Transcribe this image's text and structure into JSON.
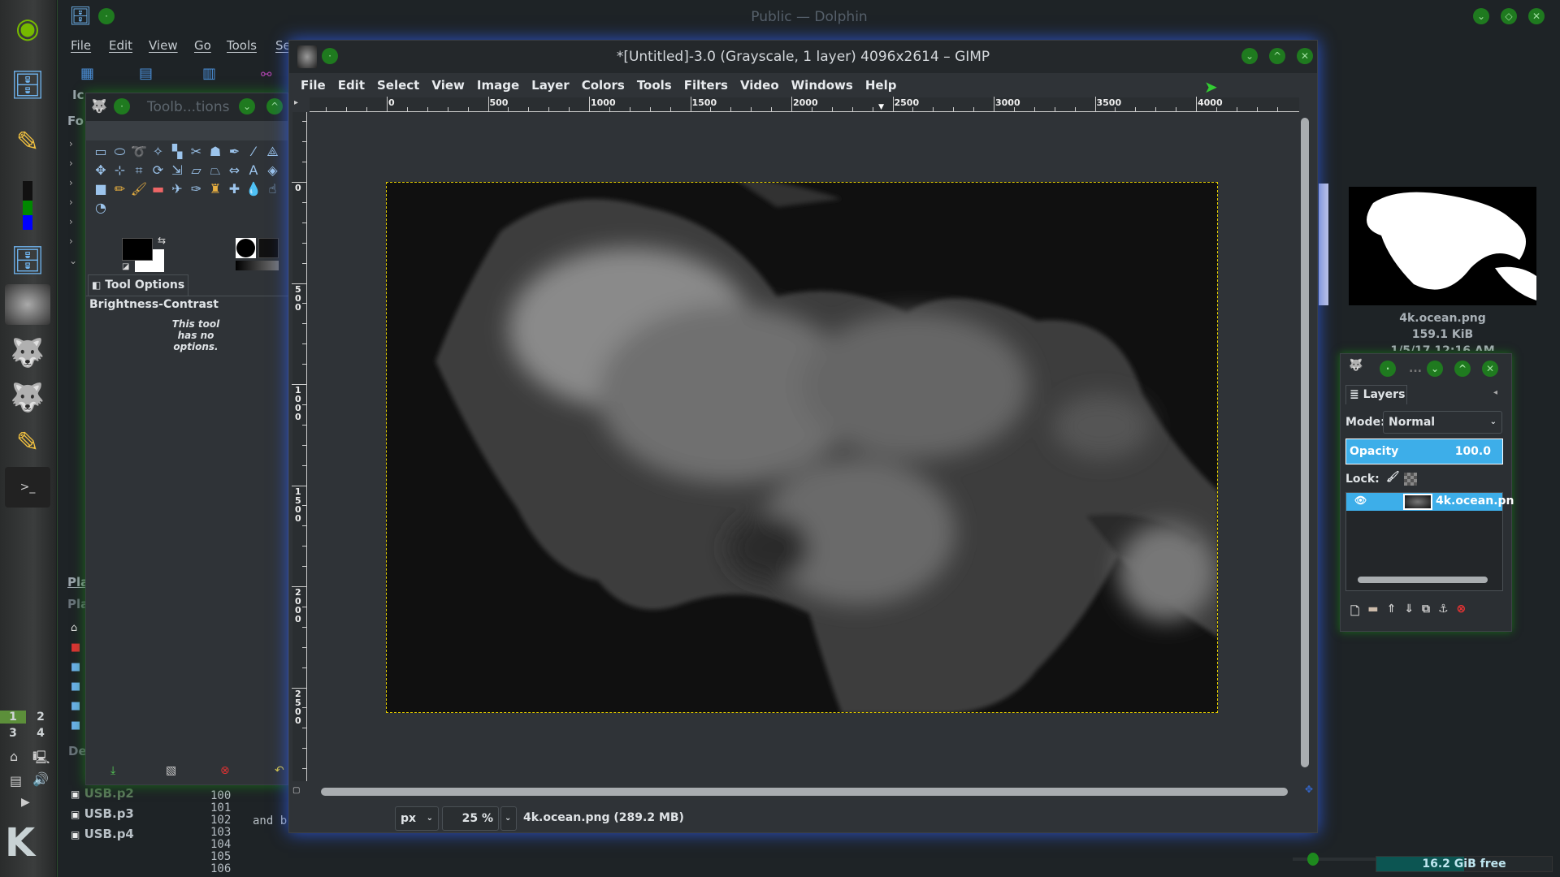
{
  "dolphin": {
    "title": "Public — Dolphin",
    "menu": [
      "File",
      "Edit",
      "View",
      "Go",
      "Tools",
      "Se"
    ],
    "sidebar_fragments": {
      "icons_tab": "Ic",
      "folders": "Fo",
      "places1": "Pla",
      "places2": "Pla",
      "devices": "De"
    },
    "devices": [
      "USB.p2",
      "USB.p3",
      "USB.p4"
    ],
    "line_numbers": [
      "100",
      "101",
      "102",
      "103",
      "104",
      "105",
      "106"
    ],
    "text_fragment": "and b",
    "preview": {
      "filename": "4k.ocean.png",
      "size": "159.1 KiB",
      "date": "1/5/17 12:16 AM"
    },
    "free_space": "16.2 GiB free",
    "free_fraction": 0.5
  },
  "kde_panel": {
    "desktops": [
      "1",
      "2",
      "3",
      "4"
    ],
    "active_desktop": "1"
  },
  "toolbox": {
    "title": "Toolb...tions",
    "tab": "Tool Options",
    "tool_name": "Brightness-Contrast",
    "no_options": "This tool has no options.",
    "tools": [
      "rect-select",
      "ellipse-select",
      "free-select",
      "fuzzy-select",
      "color-select",
      "scissors",
      "foreground-select",
      "paths",
      "color-picker",
      "measure",
      "move",
      "align",
      "crop",
      "rotate",
      "scale",
      "shear",
      "perspective",
      "flip",
      "text",
      "bucket-fill",
      "gradient",
      "pencil",
      "paintbrush",
      "eraser",
      "airbrush",
      "ink",
      "clone",
      "heal",
      "blur",
      "smudge",
      "dodge"
    ]
  },
  "gimp": {
    "title": "*[Untitled]-3.0 (Grayscale, 1 layer) 4096x2614 – GIMP",
    "menu": [
      "File",
      "Edit",
      "Select",
      "View",
      "Image",
      "Layer",
      "Colors",
      "Tools",
      "Filters",
      "Video",
      "Windows",
      "Help"
    ],
    "hruler": [
      "0",
      "500",
      "1000",
      "1500",
      "2000",
      "2500",
      "3000",
      "3500",
      "4000"
    ],
    "vruler": [
      "0",
      "500",
      "1000",
      "1500",
      "2000",
      "2500"
    ],
    "unit": "px",
    "zoom": "25 %",
    "status": "4k.ocean.png (289.2 MB)"
  },
  "layers": {
    "tab": "Layers",
    "mode_label": "Mode:",
    "mode": "Normal",
    "opacity_label": "Opacity",
    "opacity": "100.0",
    "lock_label": "Lock:",
    "layer_name": "4k.ocean.pn",
    "dots": "..."
  }
}
